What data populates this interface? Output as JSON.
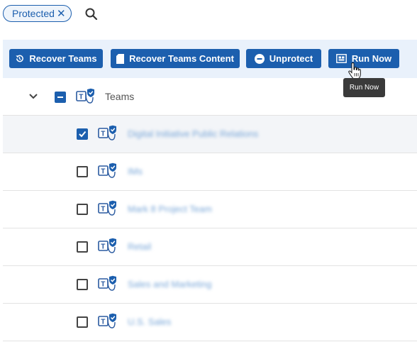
{
  "filter": {
    "chip_label": "Protected",
    "chip_close": "✕"
  },
  "toolbar": {
    "recover_teams_label": "Recover Teams",
    "recover_content_label": "Recover Teams Content",
    "unprotect_label": "Unprotect",
    "run_now_label": "Run Now"
  },
  "tooltip": {
    "text": "Run Now"
  },
  "tree": {
    "header_label": "Teams",
    "header_state": "indeterminate",
    "items": [
      {
        "label": "Digital Initiative Public Relations",
        "checked": true
      },
      {
        "label": "IMs",
        "checked": false
      },
      {
        "label": "Mark 8 Project Team",
        "checked": false
      },
      {
        "label": "Retail",
        "checked": false
      },
      {
        "label": "Sales and Marketing",
        "checked": false
      },
      {
        "label": "U.S. Sales",
        "checked": false
      }
    ]
  },
  "colors": {
    "accent": "#1c5fae",
    "toolbar_bg": "#e9f1fb",
    "tooltip_bg": "#3a3a3a"
  },
  "icons": {
    "search": "search-icon",
    "recover_teams": "history-icon",
    "recover_content": "document-icon",
    "unprotect": "minus-circle-icon",
    "run_now": "run-now-icon",
    "team": "teams-shield-icon",
    "expand": "chevron-down-icon",
    "cursor": "hand-pointer-icon"
  }
}
